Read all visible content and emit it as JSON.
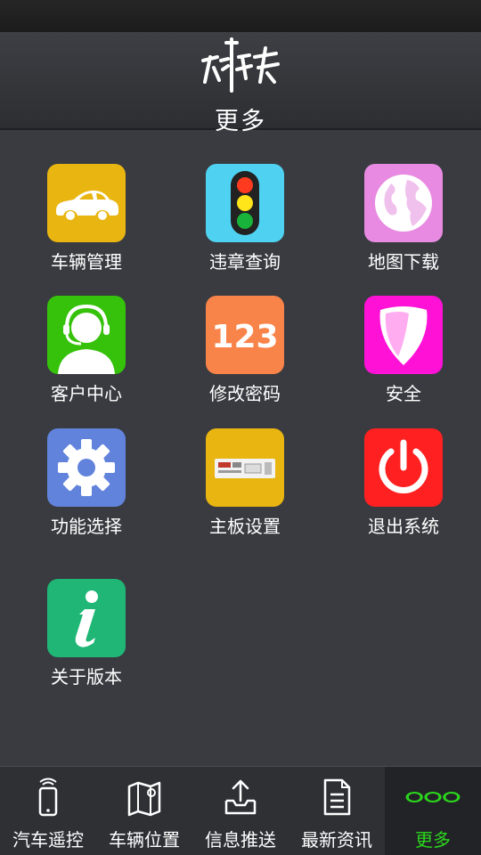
{
  "header": {
    "logo_text": "领将者",
    "title": "更多"
  },
  "grid": {
    "items": [
      {
        "label": "车辆管理",
        "icon": "car-icon",
        "color": "#e8b511"
      },
      {
        "label": "违章查询",
        "icon": "traffic-light-icon",
        "color": "#4fd2f1"
      },
      {
        "label": "地图下载",
        "icon": "globe-icon",
        "color": "#e88ae2"
      },
      {
        "label": "客户中心",
        "icon": "customer-service-icon",
        "color": "#36c10a"
      },
      {
        "label": "修改密码",
        "icon": "password-123-icon",
        "color": "#f9844a"
      },
      {
        "label": "安全",
        "icon": "shield-icon",
        "color": "#ff11d6"
      },
      {
        "label": "功能选择",
        "icon": "gear-icon",
        "color": "#6183dc"
      },
      {
        "label": "主板设置",
        "icon": "circuit-board-icon",
        "color": "#e8b511"
      },
      {
        "label": "退出系统",
        "icon": "power-icon",
        "color": "#ff2121"
      },
      {
        "label": "关于版本",
        "icon": "info-icon",
        "color": "#1fb676"
      }
    ]
  },
  "icon_text": {
    "password": "123"
  },
  "nav": {
    "items": [
      {
        "label": "汽车遥控",
        "icon": "remote-control-icon"
      },
      {
        "label": "车辆位置",
        "icon": "map-location-icon"
      },
      {
        "label": "信息推送",
        "icon": "upload-tray-icon"
      },
      {
        "label": "最新资讯",
        "icon": "document-icon"
      },
      {
        "label": "更多",
        "icon": "more-dots-icon",
        "active": true
      }
    ],
    "active_color": "#2bd61d"
  }
}
